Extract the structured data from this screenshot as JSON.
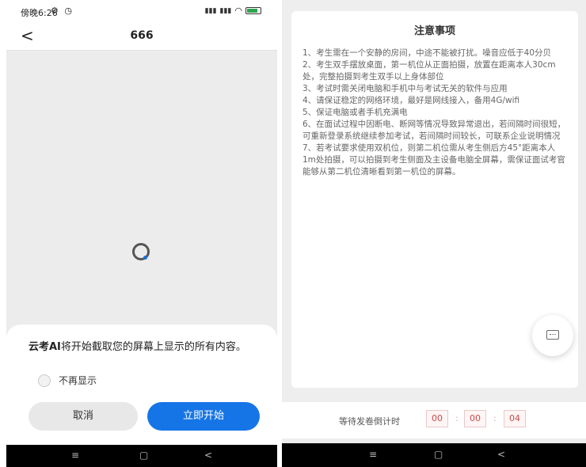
{
  "left": {
    "status": {
      "time": "傍晚6:26",
      "icons": "⚙ ◷"
    },
    "nav": {
      "back_glyph": "<",
      "title": "666"
    },
    "dialog": {
      "app_name": "云考AI",
      "message_rest": "将开始截取您的屏幕上显示的所有内容。",
      "dont_show_label": "不再显示",
      "cancel_label": "取消",
      "start_label": "立即开始"
    },
    "sysnav": {
      "menu": "≡",
      "home": "▢",
      "back": "<"
    }
  },
  "right": {
    "title": "注意事项",
    "notices": [
      "1、考生需在一个安静的房间，中途不能被打扰。噪音应低于40分贝",
      "2、考生双手摆放桌面，第一机位从正面拍摄，放置在距离本人30cm处，完整拍摄到考生双手以上身体部位",
      "3、考试时需关闭电脑和手机中与考试无关的软件与应用",
      "4、请保证稳定的网络环境，最好是网线接入，备用4G/wifi",
      "5、保证电脑或者手机充满电",
      "6、在面试过程中因断电、断网等情况导致异常退出，若间隔时间很短，可重新登录系统继续参加考试，若间隔时间较长，可联系企业说明情况",
      "7、若考试要求使用双机位，则第二机位需从考生侧后方45°距离本人1m处拍摄，可以拍摄到考生侧面及主设备电脑全屏幕，需保证面试考官能够从第二机位清晰看到第一机位的屏幕。"
    ],
    "countdown": {
      "label": "等待发卷倒计时",
      "h": "00",
      "m": "00",
      "s": "04",
      "sep": ":"
    },
    "sysnav": {
      "menu": "≡",
      "home": "▢",
      "back": "<"
    }
  },
  "colors": {
    "primary": "#1675e6",
    "countdown_text": "#c94b4b"
  }
}
